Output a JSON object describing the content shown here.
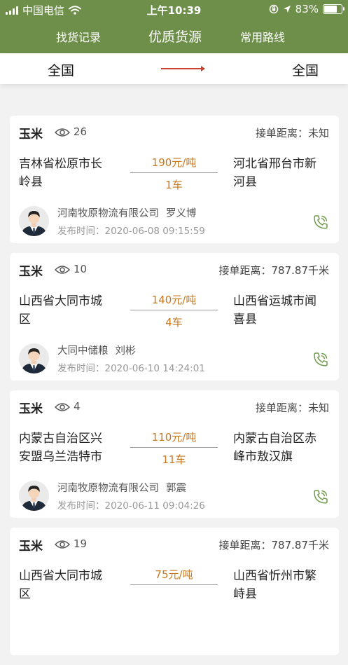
{
  "status_bar": {
    "carrier": "中国电信",
    "time": "上午10:39",
    "battery": "83%",
    "battery_level": 0.83
  },
  "nav": {
    "tabs": [
      "找货记录",
      "优质货源",
      "常用路线"
    ],
    "active_index": 1
  },
  "route": {
    "from": "全国",
    "to": "全国"
  },
  "labels": {
    "distance": "接单距离：",
    "publish_time": "发布时间："
  },
  "colors": {
    "header": "#6e8f4a",
    "price": "#c8781f",
    "arrow": "#c9412f",
    "phone": "#6e9a4c"
  },
  "cargo": [
    {
      "goods": "玉米",
      "views": "26",
      "distance": "未知",
      "from": "吉林省松原市长岭县",
      "to": "河北省邢台市新河县",
      "price": "190元/吨",
      "trucks": "1车",
      "company": "河南牧原物流有限公司",
      "person": "罗义博",
      "time": "2020-06-08 09:15:59"
    },
    {
      "goods": "玉米",
      "views": "10",
      "distance": "787.87千米",
      "from": "山西省大同市城区",
      "to": "山西省运城市闻喜县",
      "price": "140元/吨",
      "trucks": "4车",
      "company": "大同中储粮",
      "person": "刘彬",
      "time": "2020-06-10 14:24:01"
    },
    {
      "goods": "玉米",
      "views": "4",
      "distance": "未知",
      "from": "内蒙古自治区兴安盟乌兰浩特市",
      "to": "内蒙古自治区赤峰市敖汉旗",
      "price": "110元/吨",
      "trucks": "11车",
      "company": "河南牧原物流有限公司",
      "person": "郭震",
      "time": "2020-06-11 09:04:26"
    },
    {
      "goods": "玉米",
      "views": "19",
      "distance": "787.87千米",
      "from": "山西省大同市城区",
      "to": "山西省忻州市繁峙县",
      "price": "75元/吨",
      "trucks": "",
      "company": "",
      "person": "",
      "time": ""
    }
  ]
}
